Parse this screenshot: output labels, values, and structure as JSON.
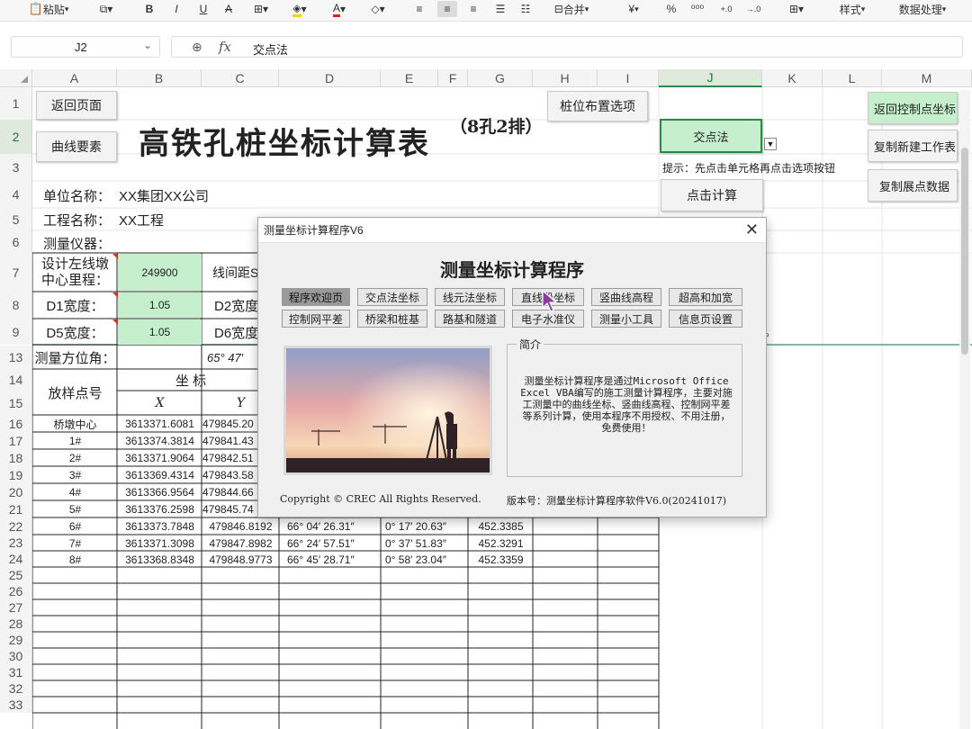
{
  "ribbon": {
    "paste": "粘贴",
    "bold": "B",
    "italic": "I",
    "underline": "U",
    "strike": "A",
    "merge": "合并",
    "currency": "¥",
    "percent": "%",
    "styles": "样式",
    "data_process": "数据处理"
  },
  "formula_bar": {
    "cell_ref": "J2",
    "formula": "交点法"
  },
  "columns": [
    "A",
    "B",
    "C",
    "D",
    "E",
    "F",
    "G",
    "H",
    "I",
    "J",
    "K",
    "L",
    "M"
  ],
  "rows": [
    "1",
    "2",
    "3",
    "4",
    "5",
    "6",
    "7",
    "8",
    "9",
    "13",
    "14",
    "15",
    "16",
    "17",
    "18",
    "19",
    "20",
    "21",
    "22",
    "23",
    "24",
    "25",
    "26",
    "27",
    "28",
    "29",
    "30",
    "31",
    "32",
    "33"
  ],
  "sheet": {
    "back_button": "返回页面",
    "curve_button": "曲线要素",
    "title": "高铁孔桩坐标计算表",
    "title_note": "（8孔2排）",
    "layout_button": "桩位布置选项",
    "method_dropdown": "交点法",
    "hint": "提示：先点击单元格再点击选项按钮",
    "calc_button": "点击计算",
    "right_buttons": [
      "返回控制点坐标",
      "复制新建工作表",
      "复制展点数据"
    ],
    "unit_label": "单位名称：",
    "unit_value": "XX集团XX公司",
    "project_label": "工程名称：",
    "project_value": "XX工程",
    "instrument_label": "测量仪器：",
    "mileage_label": "设计左线墩中心里程：",
    "mileage_value": "249900",
    "line_spacing_label": "线间距S",
    "d1_label": "D1宽度：",
    "d1_value": "1.05",
    "d2_label": "D2宽度",
    "d5_label": "D5宽度：",
    "d5_value": "1.05",
    "d6_label": "D6宽度",
    "azimuth_label": "测量方位角：",
    "azimuth_value": "65° 47′",
    "point_header": "放样点号",
    "coord_header": "坐  标",
    "x_header": "X",
    "y_header": "Y",
    "data_rows": [
      {
        "point": "桥墩中心",
        "x": "3613371.6081",
        "y": "479845.20",
        "d": "",
        "e": "",
        "g": ""
      },
      {
        "point": "1#",
        "x": "3613374.3814",
        "y": "479841.43",
        "d": "",
        "e": "",
        "g": ""
      },
      {
        "point": "2#",
        "x": "3613371.9064",
        "y": "479842.51",
        "d": "",
        "e": "",
        "g": ""
      },
      {
        "point": "3#",
        "x": "3613369.4314",
        "y": "479843.58",
        "d": "",
        "e": "",
        "g": ""
      },
      {
        "point": "4#",
        "x": "3613366.9564",
        "y": "479844.66",
        "d": "",
        "e": "",
        "g": ""
      },
      {
        "point": "5#",
        "x": "3613376.2598",
        "y": "479845.74",
        "d": "",
        "e": "",
        "g": ""
      },
      {
        "point": "6#",
        "x": "3613373.7848",
        "y": "479846.8192",
        "d": "66° 04′ 26.31″",
        "e": "0° 17′ 20.63″",
        "g": "452.3385"
      },
      {
        "point": "7#",
        "x": "3613371.3098",
        "y": "479847.8982",
        "d": "66° 24′ 57.51″",
        "e": "0° 37′ 51.83″",
        "g": "452.3291"
      },
      {
        "point": "8#",
        "x": "3613368.8348",
        "y": "479848.9773",
        "d": "66° 45′ 28.71″",
        "e": "0° 58′ 23.04″",
        "g": "452.3359"
      }
    ],
    "stray_mark": "。"
  },
  "dialog": {
    "window_title": "测量坐标计算程序V6",
    "close": "✕",
    "heading": "测量坐标计算程序",
    "tabs_row1": [
      "程序欢迎页",
      "交点法坐标",
      "线元法坐标",
      "直线段坐标",
      "竖曲线高程",
      "超高和加宽"
    ],
    "tabs_row2": [
      "控制网平差",
      "桥梁和桩基",
      "路基和隧道",
      "电子水准仪",
      "测量小工具",
      "信息页设置"
    ],
    "intro_legend": "简介",
    "intro_text": "测量坐标计算程序是通过Microsoft Office Excel VBA编写的施工测量计算程序，主要对施工测量中的曲线坐标、竖曲线高程、控制网平差等系列计算，使用本程序不用授权、不用注册，免费使用！",
    "copyright": "Copyright © CREC All Rights Reserved.",
    "version": "版本号：测量坐标计算程序软件V6.0(20241017)"
  },
  "colors": {
    "accent_green": "#2a8a4a",
    "cell_green": "#c6efce",
    "selected_tab": "#9a9a9a"
  }
}
